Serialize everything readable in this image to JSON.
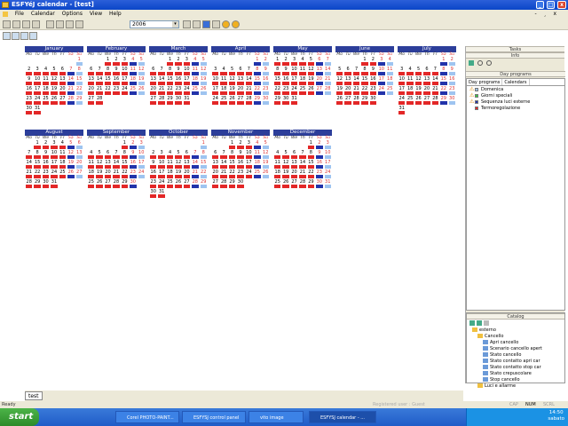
{
  "window": {
    "title": "ESFYéJ calendar - [test]"
  },
  "menu": {
    "items": [
      "File",
      "Calendar",
      "Options",
      "View",
      "Help"
    ],
    "mdi": "- ¸ x"
  },
  "toolbar": {
    "year": "2006"
  },
  "day_headers": [
    "Mo",
    "Tu",
    "We",
    "Th",
    "Fr",
    "Sa",
    "Su"
  ],
  "months": [
    {
      "name": "January",
      "start": 6,
      "days": 31
    },
    {
      "name": "February",
      "start": 2,
      "days": 28
    },
    {
      "name": "March",
      "start": 2,
      "days": 31
    },
    {
      "name": "April",
      "start": 5,
      "days": 30
    },
    {
      "name": "May",
      "start": 0,
      "days": 31
    },
    {
      "name": "June",
      "start": 3,
      "days": 30
    },
    {
      "name": "July",
      "start": 5,
      "days": 31
    },
    {
      "name": "August",
      "start": 1,
      "days": 31
    },
    {
      "name": "September",
      "start": 4,
      "days": 30
    },
    {
      "name": "October",
      "start": 6,
      "days": 31
    },
    {
      "name": "November",
      "start": 2,
      "days": 30
    },
    {
      "name": "December",
      "start": 4,
      "days": 31
    }
  ],
  "right_panel": {
    "tasks_title": "Tasks",
    "info_title": "Info",
    "day_programs_title": "Day programs",
    "tabs": [
      "Day programs",
      "Calendars"
    ],
    "programs": [
      {
        "label": "Domenica",
        "color": "#9ec4f0",
        "warn": true
      },
      {
        "label": "Giorni speciali",
        "color": "#36c942",
        "warn": true
      },
      {
        "label": "Sequenza luci esterne",
        "color": "#2233aa",
        "warn": true
      },
      {
        "label": "Termoregolazione",
        "color": "#e32727",
        "warn": false
      }
    ],
    "catalog_title": "Catalog",
    "catalog_tree": [
      "esterno",
      "Cancello",
      "Apri cancello",
      "Scenario cancello apert",
      "Stato cancello",
      "Stato contatto apri car",
      "Stato contatto stop car",
      "Stato crepuscolare",
      "Stop cancello",
      "Luci e allarme"
    ]
  },
  "document_tab": "test",
  "status": {
    "left": "Ready",
    "registered": "Registered user : Guest",
    "caps": "CAP",
    "num": "NUM",
    "scrl": "SCRL"
  },
  "taskbar": {
    "start": "start",
    "tasks": [
      "Corel PHOTO-PAINT...",
      "ESFYSJ control panel",
      "vito image",
      "ESFYSJ calendar - ..."
    ],
    "time": "14:50",
    "day": "sabato"
  }
}
